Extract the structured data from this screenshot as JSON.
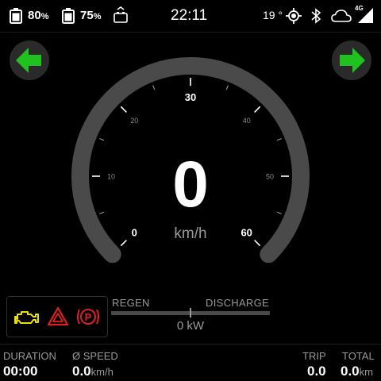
{
  "status": {
    "battery1_value": "80",
    "battery1_unit": "%",
    "battery2_value": "75",
    "battery2_unit": "%",
    "time": "22:11",
    "temperature": "19 °",
    "network": "4G",
    "battery1_level": 0.8,
    "battery2_level": 0.75
  },
  "gauge": {
    "speed": "0",
    "unit": "km/h",
    "ticks": [
      "0",
      "10",
      "20",
      "30",
      "40",
      "50",
      "60"
    ],
    "min": 0,
    "max": 60,
    "current": 0
  },
  "power": {
    "regen_label": "REGEN",
    "discharge_label": "DISCHARGE",
    "value": "0 kW"
  },
  "stats": {
    "duration_label": "DURATION",
    "duration_value": "00:00",
    "avg_speed_label": "Ø SPEED",
    "avg_speed_value": "0.0",
    "avg_speed_unit": "km/h",
    "trip_label": "TRIP",
    "trip_value": "0.0",
    "total_label": "TOTAL",
    "total_value": "0.0",
    "total_unit": "km"
  },
  "colors": {
    "turn_arrow": "#1fc21f",
    "engine_warning": "#e8e000",
    "hazard": "#e02020",
    "parking_brake": "#e02020"
  }
}
